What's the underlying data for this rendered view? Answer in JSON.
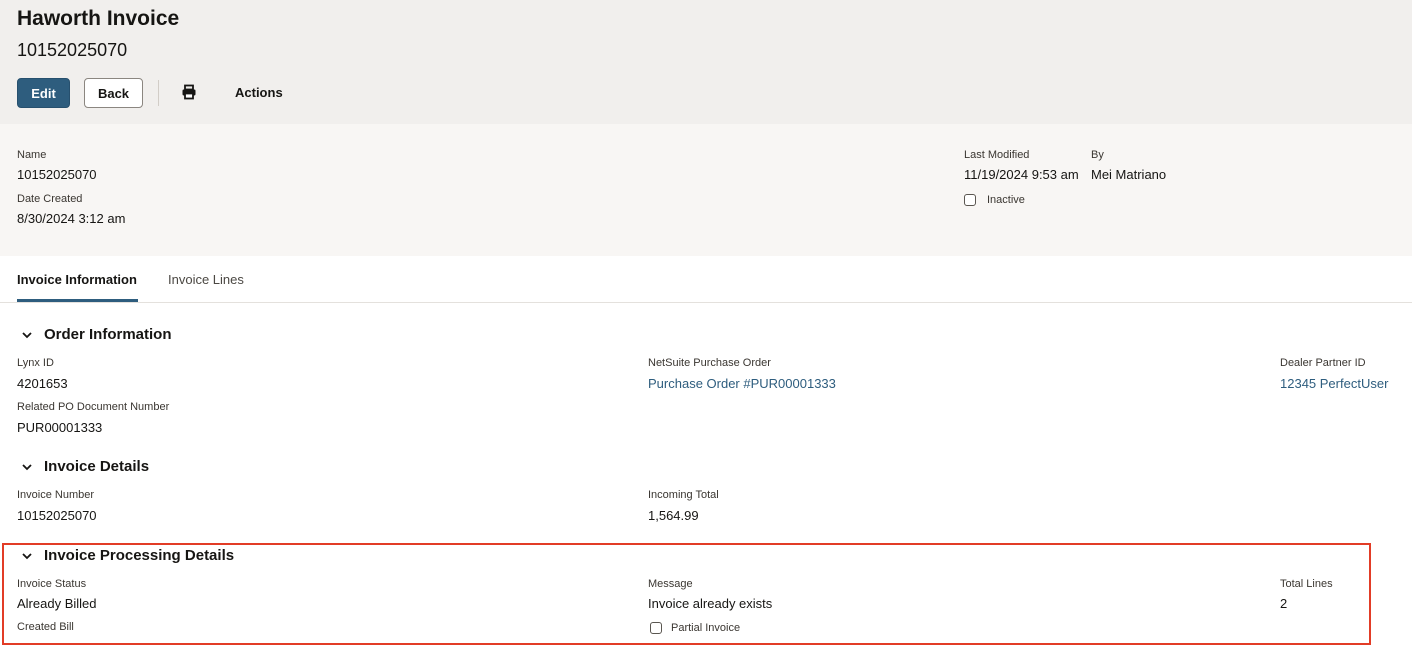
{
  "header": {
    "title": "Haworth Invoice",
    "subtitle": "10152025070",
    "edit_label": "Edit",
    "back_label": "Back",
    "actions_label": "Actions"
  },
  "summary": {
    "name_label": "Name",
    "name_value": "10152025070",
    "date_created_label": "Date Created",
    "date_created_value": "8/30/2024 3:12 am",
    "last_modified_label": "Last Modified",
    "last_modified_value": "11/19/2024 9:53 am",
    "by_label": "By",
    "by_value": "Mei Matriano",
    "inactive_label": "Inactive",
    "inactive_checked": false
  },
  "tabs": [
    {
      "label": "Invoice Information",
      "active": true
    },
    {
      "label": "Invoice Lines",
      "active": false
    }
  ],
  "order_info": {
    "heading": "Order Information",
    "lynx_id_label": "Lynx ID",
    "lynx_id_value": "4201653",
    "related_po_label": "Related PO Document Number",
    "related_po_value": "PUR00001333",
    "netsuite_po_label": "NetSuite Purchase Order",
    "netsuite_po_value": "Purchase Order #PUR00001333",
    "dealer_partner_label": "Dealer Partner ID",
    "dealer_partner_value": "12345 PerfectUser"
  },
  "invoice_details": {
    "heading": "Invoice Details",
    "invoice_number_label": "Invoice Number",
    "invoice_number_value": "10152025070",
    "incoming_total_label": "Incoming Total",
    "incoming_total_value": "1,564.99"
  },
  "processing_details": {
    "heading": "Invoice Processing Details",
    "status_label": "Invoice Status",
    "status_value": "Already Billed",
    "created_bill_label": "Created Bill",
    "message_label": "Message",
    "message_value": "Invoice already exists",
    "partial_invoice_label": "Partial Invoice",
    "partial_invoice_checked": false,
    "total_lines_label": "Total Lines",
    "total_lines_value": "2"
  },
  "colors": {
    "primary": "#2e5d7e",
    "highlight_border": "#e23c26",
    "header_bg": "#f1efed"
  }
}
